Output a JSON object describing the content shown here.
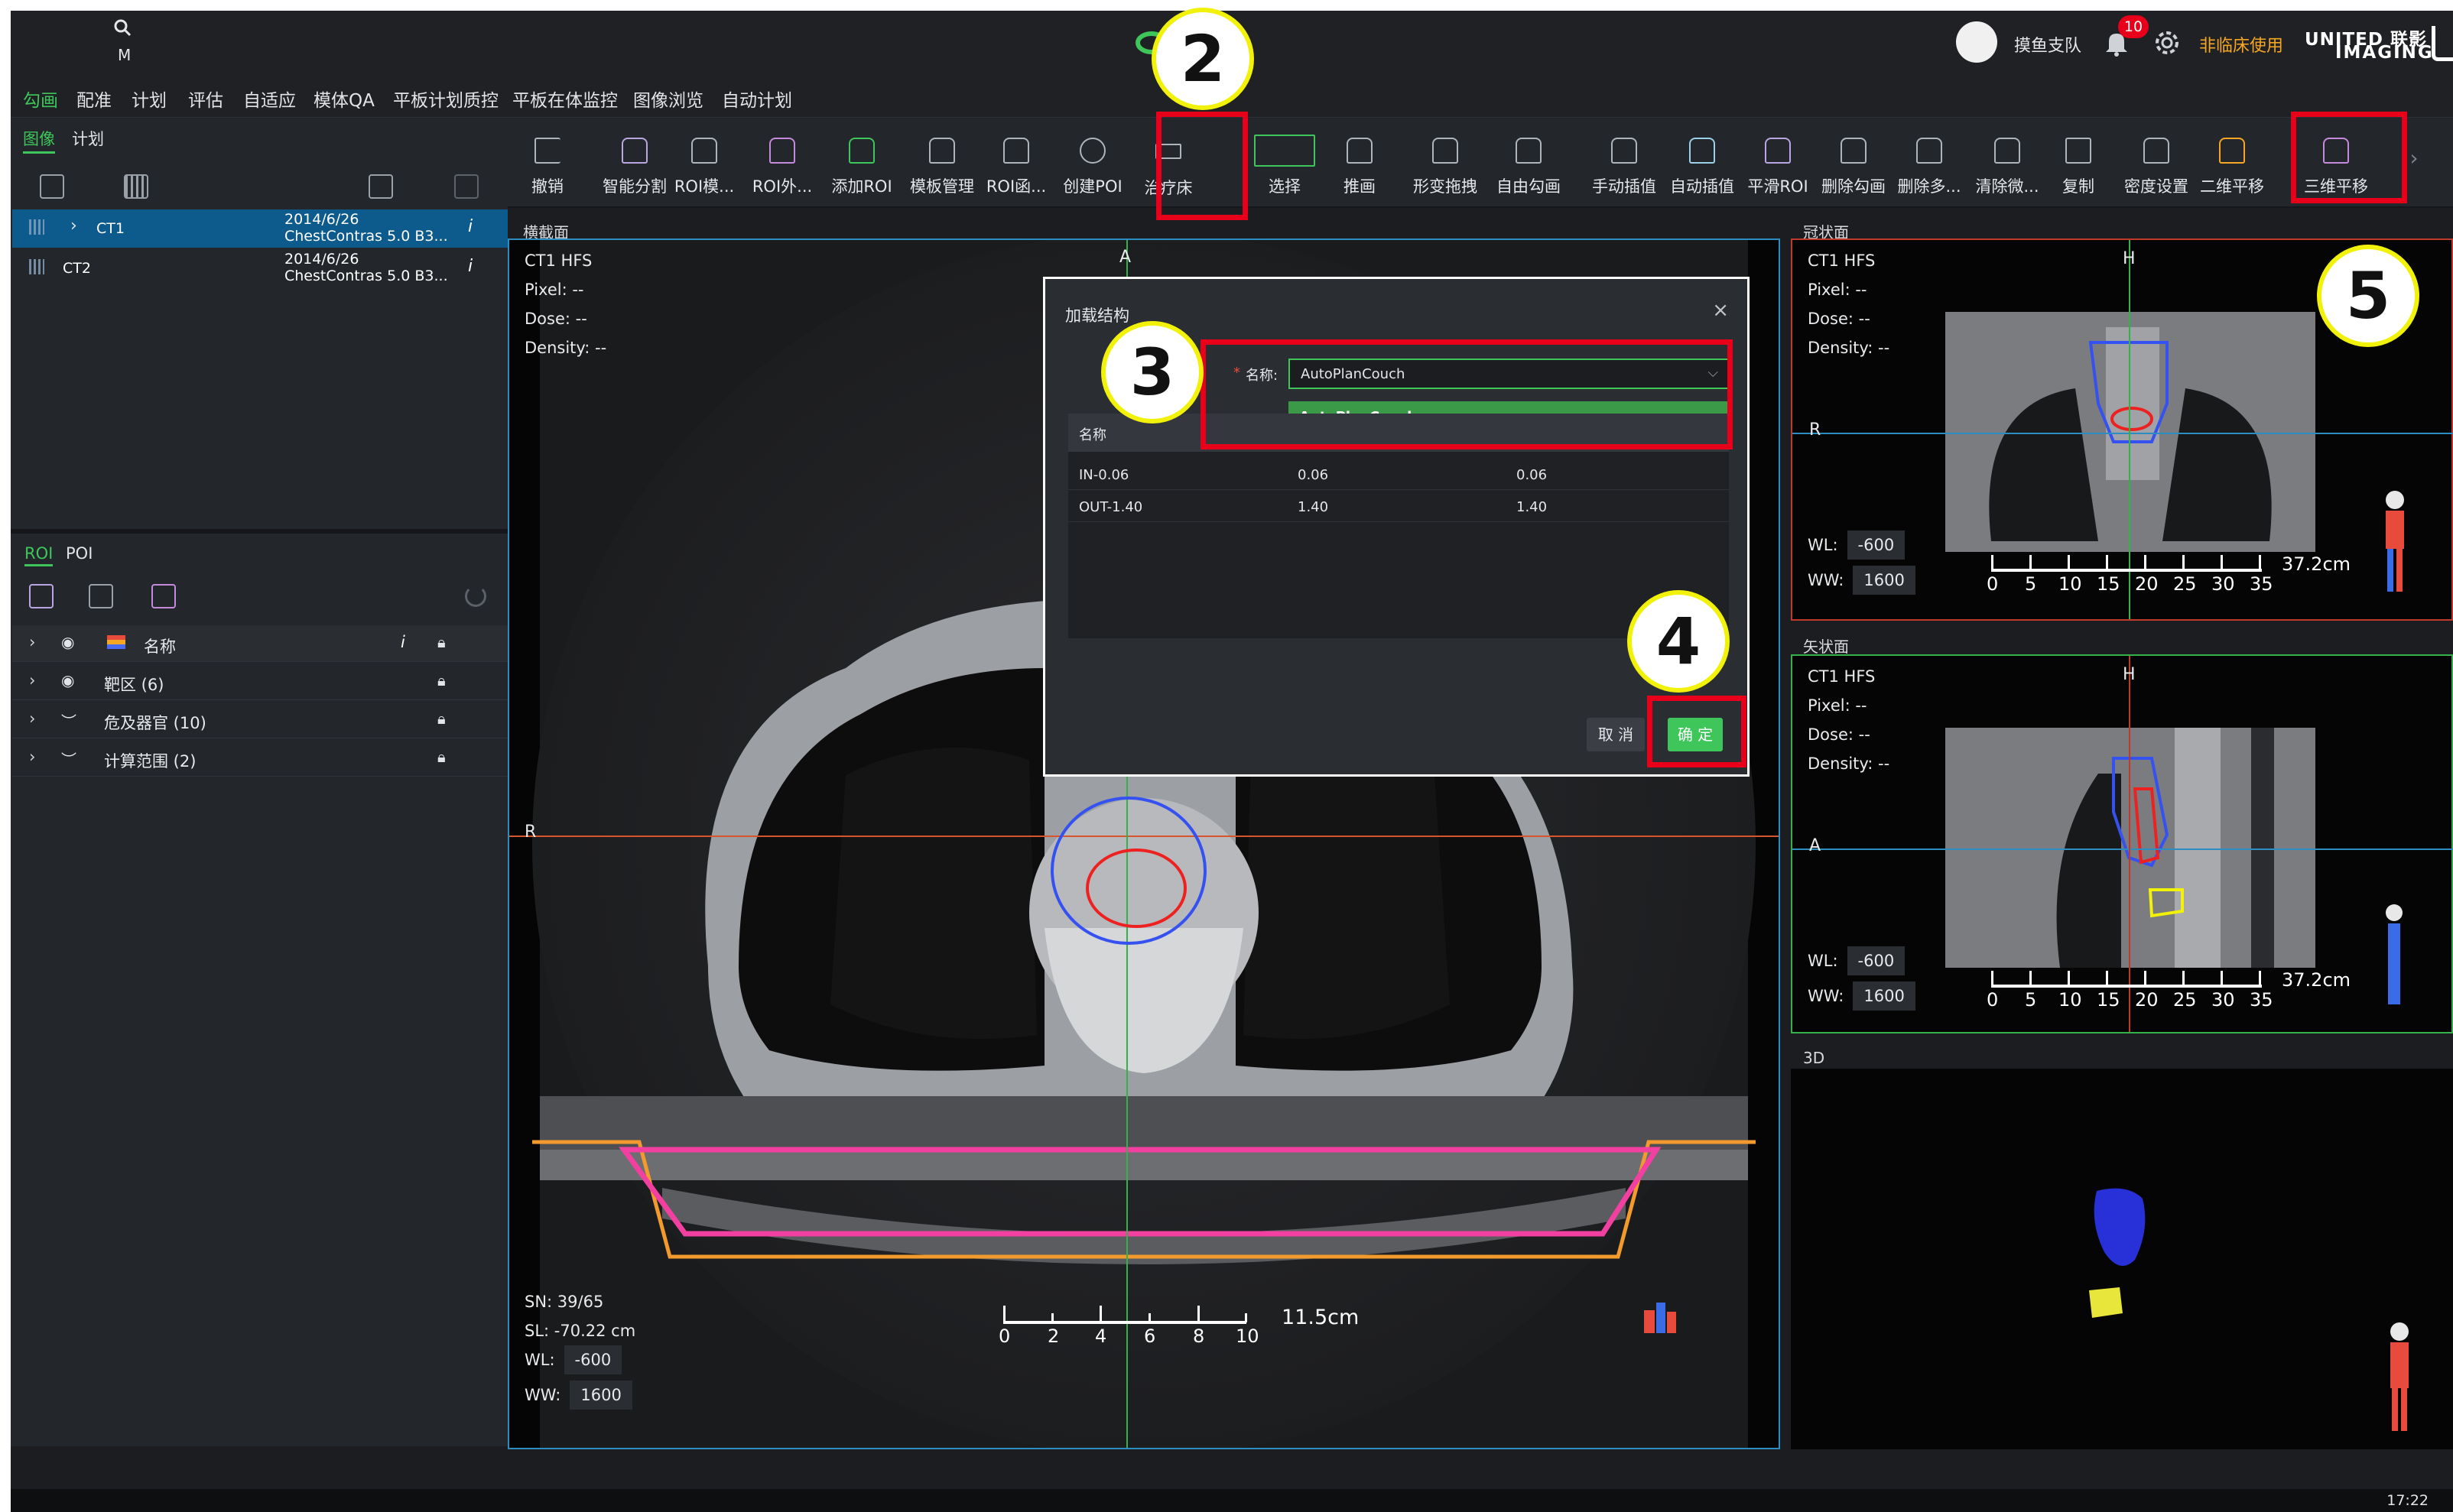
{
  "header": {
    "search_sub": "M",
    "user_name": "摸鱼支队",
    "notification_count": "10",
    "mode_label": "非临床使用",
    "brand_line1": "UNITED 联影",
    "brand_line2": "IMAGING"
  },
  "menu": [
    "勾画",
    "配准",
    "计划",
    "评估",
    "自适应",
    "模体QA",
    "平板计划质控",
    "平板在体监控",
    "图像浏览",
    "自动计划"
  ],
  "left_tabs": [
    "图像",
    "计划"
  ],
  "series": [
    {
      "name": "CT1",
      "date": "2014/6/26",
      "desc": "ChestContras 5.0 B3..."
    },
    {
      "name": "CT2",
      "date": "2014/6/26",
      "desc": "ChestContras 5.0 B3..."
    }
  ],
  "info_icon": "i",
  "roi_tabs": [
    "ROI",
    "POI"
  ],
  "roi_rows": [
    {
      "label": "名称",
      "info": "i"
    },
    {
      "label": "靶区 (6)"
    },
    {
      "label": "危及器官 (10)"
    },
    {
      "label": "计算范围 (2)"
    }
  ],
  "tools": [
    "撤销",
    "智能分割",
    "ROI模...",
    "ROI外...",
    "添加ROI",
    "模板管理",
    "ROI函...",
    "创建POI",
    "治疗床",
    "选择",
    "推画",
    "形变拖拽",
    "自由勾画",
    "手动插值",
    "自动插值",
    "平滑ROI",
    "删除勾画",
    "删除多...",
    "清除微...",
    "复制",
    "密度设置",
    "二维平移",
    "三维平移"
  ],
  "views": {
    "axial": {
      "title": "横截面",
      "series": "CT1 HFS",
      "pixel": "Pixel:  --",
      "dose": "Dose:  --",
      "density": "Density:  --",
      "top": "A",
      "left": "R",
      "sn": "SN: 39/65",
      "sl": "SL: -70.22 cm",
      "wl_label": "WL:",
      "wl": "-600",
      "ww_label": "WW:",
      "ww": "1600",
      "scale_nums": [
        "0",
        "2",
        "4",
        "6",
        "8",
        "10"
      ],
      "scale_len": "11.5cm"
    },
    "coronal": {
      "title": "冠状面",
      "series": "CT1 HFS",
      "pixel": "Pixel:  --",
      "dose": "Dose:  --",
      "density": "Density:  --",
      "top": "H",
      "left": "R",
      "wl_label": "WL:",
      "wl": "-600",
      "ww_label": "WW:",
      "ww": "1600",
      "scale_nums": [
        "0",
        "5",
        "10",
        "15",
        "20",
        "25",
        "30",
        "35"
      ],
      "scale_len": "37.2cm"
    },
    "sagittal": {
      "title": "矢状面",
      "series": "CT1 HFS",
      "pixel": "Pixel:  --",
      "dose": "Dose:  --",
      "density": "Density:  --",
      "top": "H",
      "left": "A",
      "wl_label": "WL:",
      "wl": "-600",
      "ww_label": "WW:",
      "ww": "1600",
      "scale_nums": [
        "0",
        "5",
        "10",
        "15",
        "20",
        "25",
        "30",
        "35"
      ],
      "scale_len": "37.2cm"
    },
    "3d": {
      "title": "3D"
    }
  },
  "dialog": {
    "title": "加载结构",
    "close": "×",
    "name_label": "名称:",
    "required_mark": "*",
    "selected": "AutoPlanCouch",
    "option": "AutoPlanCouch",
    "col_name": "名称",
    "rows": [
      {
        "name": "IN-0.06",
        "v1": "0.06",
        "v2": "0.06"
      },
      {
        "name": "OUT-1.40",
        "v1": "1.40",
        "v2": "1.40"
      }
    ],
    "cancel": "取 消",
    "ok": "确 定"
  },
  "markers": [
    "2",
    "3",
    "4",
    "5"
  ],
  "clock": "17:22",
  "colors": {
    "accent": "#3ec65a",
    "selection": "#0d5a8c",
    "highlight": "#e8001a",
    "marker": "#f1f10a",
    "mode": "#f5a623"
  }
}
